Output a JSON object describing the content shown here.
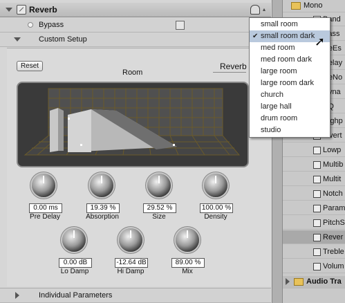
{
  "header": {
    "title": "Reverb",
    "power_icon": "power-icon",
    "menu_icon": "preset-menu-icon"
  },
  "bypass": {
    "label": "Bypass"
  },
  "custom_setup": {
    "label": "Custom Setup"
  },
  "controls": {
    "reset_label": "Reset",
    "room_label": "Room",
    "effect_name": "Reverb"
  },
  "knobs_top": [
    {
      "value": "0.00 ms",
      "label": "Pre Delay"
    },
    {
      "value": "19.39 %",
      "label": "Absorption"
    },
    {
      "value": "29.52 %",
      "label": "Size"
    },
    {
      "value": "100.00 %",
      "label": "Density"
    }
  ],
  "knobs_bottom": [
    {
      "value": "0.00 dB",
      "label": "Lo Damp"
    },
    {
      "value": "-12.64 dB",
      "label": "Hi Damp"
    },
    {
      "value": "89.00 %",
      "label": "Mix"
    }
  ],
  "footer": {
    "label": "Individual Parameters"
  },
  "presets": {
    "items": [
      "small room",
      "small room dark",
      "med room",
      "med room dark",
      "large room",
      "large room dark",
      "church",
      "large hall",
      "drum room",
      "studio"
    ],
    "selected": "small room dark"
  },
  "tree": {
    "folder_top": "Mono",
    "items": [
      "Band",
      "Bass",
      "DeEs",
      "Delay",
      "DeNo",
      "Dyna",
      "EQ",
      "Highp",
      "Invert",
      "Lowp",
      "Multib",
      "Multit",
      "Notch",
      "Param",
      "PitchS",
      "Rever",
      "Treble",
      "Volum"
    ],
    "selected": "Rever",
    "folder_bottom": "Audio Tra"
  }
}
